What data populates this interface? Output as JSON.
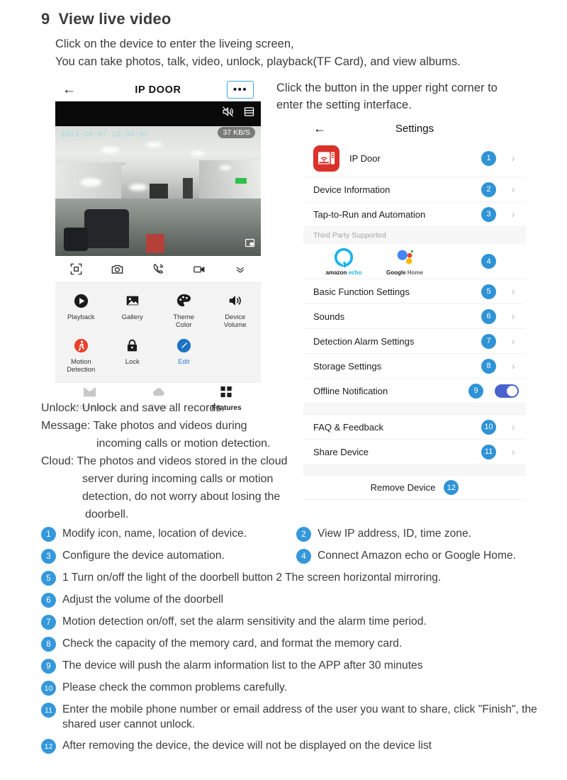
{
  "section": {
    "number": "9",
    "title": "View live video",
    "intro_line1": "Click on the device to enter the liveing screen,",
    "intro_line2": "You can take photos, talk, video, unlock, playback(TF Card), and view albums."
  },
  "right_caption": {
    "line1": "Click the button in the upper right corner to",
    "line2": "enter the setting interface."
  },
  "phone": {
    "back_icon": "back-arrow-icon",
    "title": "IP DOOR",
    "more_label": "•••",
    "video": {
      "timestamp": "2021-10-07 13:34:07",
      "bitrate": "37 KB/S",
      "mute_icon": "speaker-muted-icon",
      "list_icon": "list-icon",
      "pip_icon": "picture-in-picture-icon"
    },
    "actions": [
      {
        "name": "fullscreen-icon",
        "label": "Fullscreen"
      },
      {
        "name": "camera-icon",
        "label": "Screenshot"
      },
      {
        "name": "phone-talk-icon",
        "label": "Talk"
      },
      {
        "name": "video-record-icon",
        "label": "Record"
      },
      {
        "name": "chevron-collapse-icon",
        "label": "Collapse"
      }
    ],
    "features": [
      {
        "icon": "play-icon",
        "label": "Playback",
        "color": "#1b1b1b",
        "label_color": "#333333"
      },
      {
        "icon": "gallery-icon",
        "label": "Gallery",
        "color": "#1b1b1b",
        "label_color": "#333333"
      },
      {
        "icon": "palette-icon",
        "label": "Theme\nColor",
        "color": "#1b1b1b",
        "label_color": "#333333"
      },
      {
        "icon": "volume-icon",
        "label": "Device\nVolume",
        "color": "#1b1b1b",
        "label_color": "#333333"
      },
      {
        "icon": "motion-detection-icon",
        "label": "Motion\nDetection",
        "color": "#e8402a",
        "label_color": "#333333"
      },
      {
        "icon": "lock-icon",
        "label": "Lock",
        "color": "#1b1b1b",
        "label_color": "#333333"
      },
      {
        "icon": "edit-icon",
        "label": "Edit",
        "color": "#1d72c2",
        "label_color": "#2d7fd6"
      }
    ],
    "tabs": [
      {
        "icon": "messages-icon",
        "label": "Messages",
        "active": false
      },
      {
        "icon": "cloud-icon",
        "label": "Cloud",
        "active": false
      },
      {
        "icon": "features-grid-icon",
        "label": "Features",
        "active": true
      }
    ]
  },
  "settings": {
    "back_icon": "back-arrow-icon",
    "title": "Settings",
    "device_name": "IP Door",
    "device_icon": "ip-doorbell-icon",
    "third_party_header": "Third Party Supported",
    "logos": [
      {
        "name": "amazon-echo-logo",
        "caption_a": "amazon",
        "caption_b": " echo"
      },
      {
        "name": "google-home-logo",
        "caption_a": "Google",
        "caption_b": " Home"
      }
    ],
    "rows": [
      {
        "label": "IP Door",
        "badge": "1",
        "chevron": true,
        "type": "device"
      },
      {
        "label": "Device Information",
        "badge": "2",
        "chevron": true,
        "type": "normal"
      },
      {
        "label": "Tap-to-Run and Automation",
        "badge": "3",
        "chevron": true,
        "type": "normal"
      },
      {
        "label": "",
        "badge": "4",
        "chevron": false,
        "type": "logos"
      },
      {
        "label": "Basic Function Settings",
        "badge": "5",
        "chevron": true,
        "type": "normal"
      },
      {
        "label": "Sounds",
        "badge": "6",
        "chevron": true,
        "type": "normal"
      },
      {
        "label": "Detection Alarm Settings",
        "badge": "7",
        "chevron": true,
        "type": "normal"
      },
      {
        "label": "Storage Settings",
        "badge": "8",
        "chevron": true,
        "type": "normal"
      },
      {
        "label": "Offline Notification",
        "badge": "9",
        "chevron": false,
        "type": "toggle",
        "toggle_on": true
      },
      {
        "label": "FAQ & Feedback",
        "badge": "10",
        "chevron": true,
        "type": "normal"
      },
      {
        "label": "Share Device",
        "badge": "11",
        "chevron": true,
        "type": "normal"
      },
      {
        "label": "Remove Device",
        "badge": "12",
        "chevron": false,
        "type": "remove"
      }
    ]
  },
  "description": {
    "l1": "Unlock: Unlock and save all records.",
    "l2": "Message: Take photos and videos during",
    "l3": "incoming calls or motion detection.",
    "l4": "Cloud: The photos and videos stored in the cloud",
    "l5": "server during incoming calls or motion",
    "l6": "detection, do not worry about losing the",
    "l7": "doorbell."
  },
  "notes": [
    {
      "n": "1",
      "text": "Modify icon, name, location of device."
    },
    {
      "n": "2",
      "text": "View IP address, ID, time zone."
    },
    {
      "n": "3",
      "text": "Configure the device automation."
    },
    {
      "n": "4",
      "text": "Connect Amazon echo or Google Home."
    },
    {
      "n": "5",
      "text": "1  Turn on/off the light of the doorbell button  2  The screen horizontal mirroring."
    },
    {
      "n": "6",
      "text": "Adjust the volume of the doorbell"
    },
    {
      "n": "7",
      "text": "Motion detection on/off, set the alarm sensitivity and the alarm time period."
    },
    {
      "n": "8",
      "text": "Check the capacity of the memory card, and format the memory card."
    },
    {
      "n": "9",
      "text": "The device will push the alarm information list to the APP after 30 minutes"
    },
    {
      "n": "10",
      "text": "Please check the common problems carefully."
    },
    {
      "n": "11",
      "text": "Enter the mobile phone number or email address of the user you want to share, click \"Finish\", the shared user cannot unlock."
    },
    {
      "n": "12",
      "text": "After removing the device, the device will not be displayed on the device list"
    }
  ],
  "colors": {
    "badge_blue": "#2f93d6",
    "note_blue": "#3498db",
    "device_red": "#d8322b",
    "toggle_on": "#4a62cf",
    "accent_border": "#3aa7e0"
  }
}
